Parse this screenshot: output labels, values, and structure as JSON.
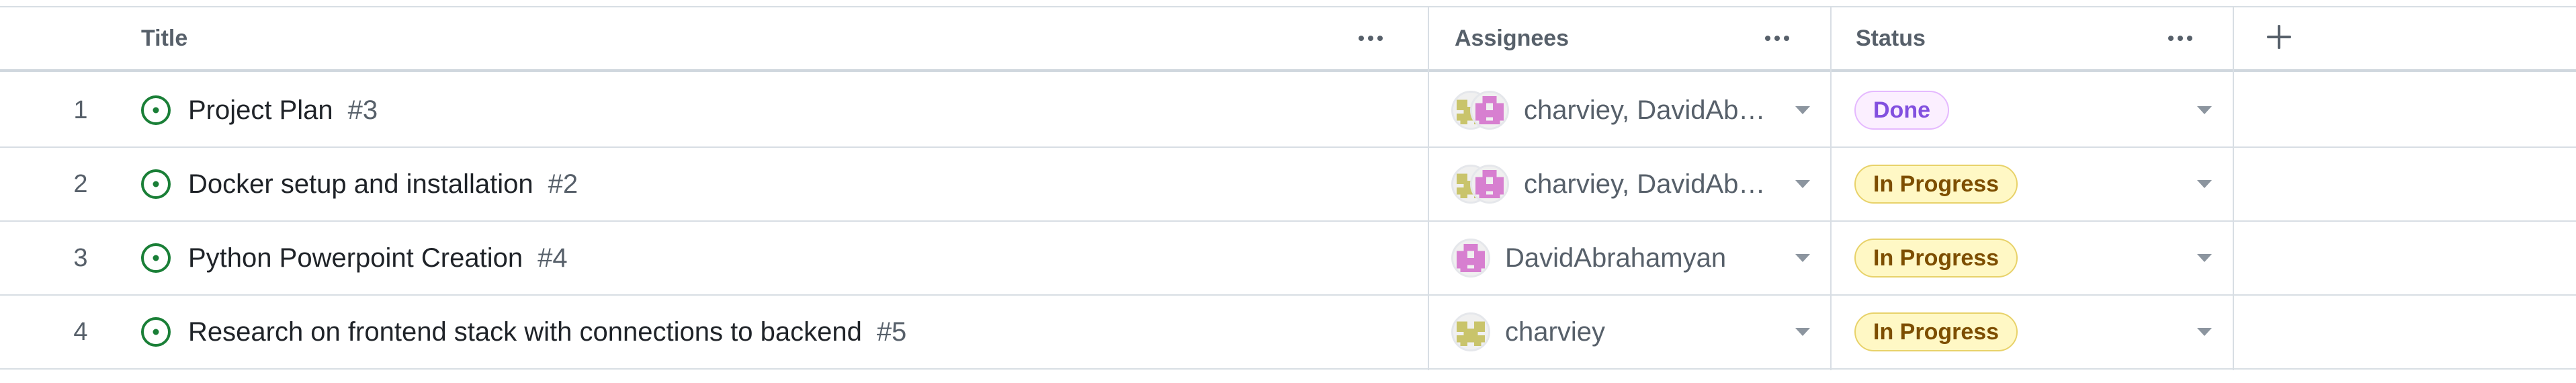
{
  "header": {
    "title_label": "Title",
    "assignees_label": "Assignees",
    "status_label": "Status",
    "add_field_icon": "plus-icon"
  },
  "colors": {
    "done_bg": "#fbefff",
    "done_text": "#8250df",
    "in_progress_bg": "#fff8c5",
    "in_progress_text": "#7d4e00",
    "open_issue_icon": "#1a7f37"
  },
  "rows": [
    {
      "num": "1",
      "title": "Project Plan",
      "issue": "#3",
      "assignees": "charviey, DavidAb…",
      "avatars": [
        "charviey",
        "DavidAbrahamyan"
      ],
      "status": "Done"
    },
    {
      "num": "2",
      "title": "Docker setup and installation",
      "issue": "#2",
      "assignees": "charviey, DavidAb…",
      "avatars": [
        "charviey",
        "DavidAbrahamyan"
      ],
      "status": "In Progress"
    },
    {
      "num": "3",
      "title": "Python Powerpoint Creation",
      "issue": "#4",
      "assignees": "DavidAbrahamyan",
      "avatars": [
        "DavidAbrahamyan"
      ],
      "status": "In Progress"
    },
    {
      "num": "4",
      "title": "Research on frontend stack with connections to backend",
      "issue": "#5",
      "assignees": "charviey",
      "avatars": [
        "charviey"
      ],
      "status": "In Progress"
    }
  ]
}
